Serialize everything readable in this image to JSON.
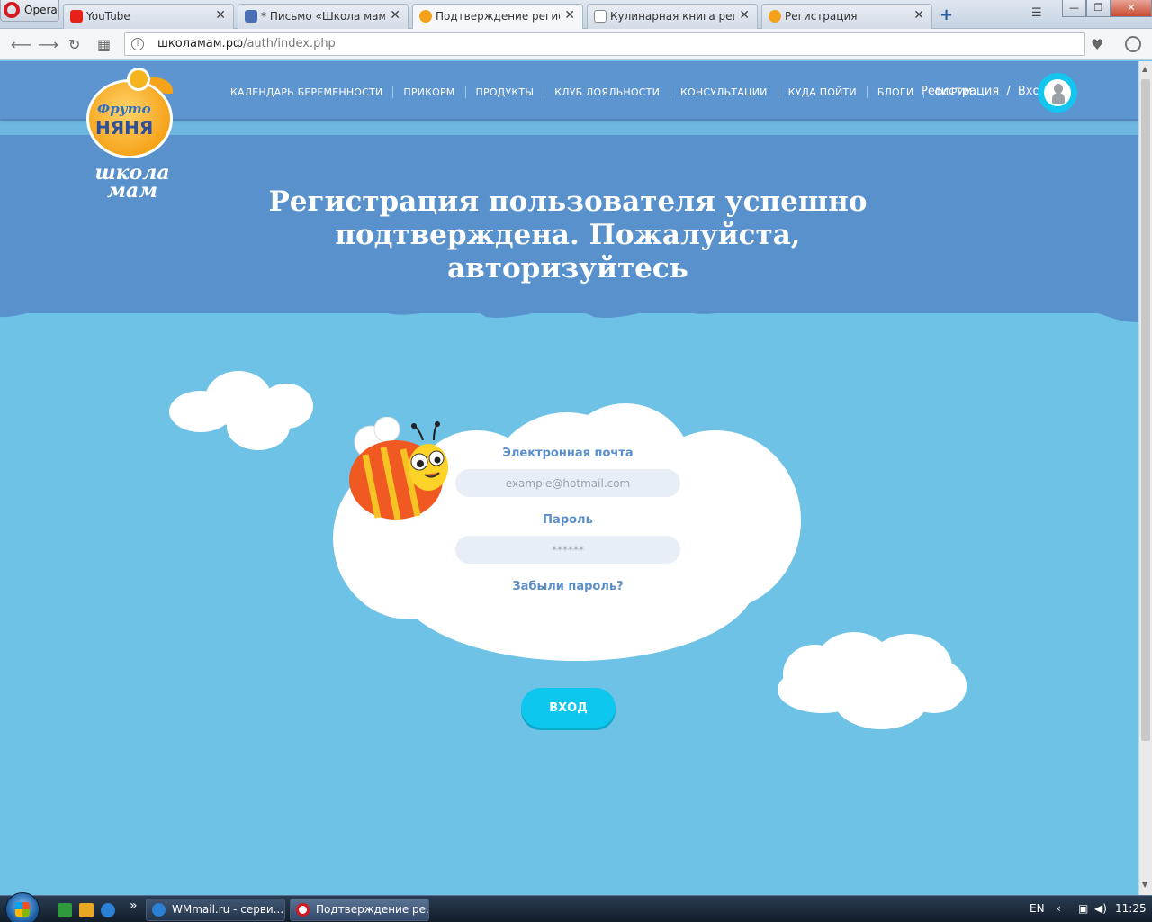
{
  "browser": {
    "menu_label": "Opera",
    "tabs": [
      {
        "title": "YouTube",
        "icon": "youtube-icon",
        "color": "#e62117"
      },
      {
        "title": "* Письмо «Школа мам: П",
        "icon": "mail-icon",
        "color": "#4a6fb5"
      },
      {
        "title": "Подтверждение регистра",
        "icon": "flower-icon",
        "color": "#f4a21b"
      },
      {
        "title": "Кулинарная книга рецеп",
        "icon": "document-icon",
        "color": "#8a8a8a"
      },
      {
        "title": "Регистрация",
        "icon": "flower-icon",
        "color": "#f4a21b"
      }
    ],
    "url_host": "школамам.рф",
    "url_path": "/auth/index.php"
  },
  "site": {
    "nav": [
      "КАЛЕНДАРЬ БЕРЕМЕННОСТИ",
      "ПРИКОРМ",
      "ПРОДУКТЫ",
      "КЛУБ ЛОЯЛЬНОСТИ",
      "КОНСУЛЬТАЦИИ",
      "КУДА ПОЙТИ",
      "БЛОГИ",
      "ФОРУМ"
    ],
    "register_link": "Регистрация",
    "auth_sep": "/",
    "login_link": "Вход",
    "logo": {
      "line1": "Фруто",
      "line2": "НЯНЯ",
      "line3": "школа мам"
    },
    "headline": "Регистрация пользователя успешно подтверждена. Пожалуйста, авторизуйтесь"
  },
  "form": {
    "email_label": "Электронная почта",
    "email_placeholder": "example@hotmail.com",
    "password_label": "Пароль",
    "password_placeholder": "******",
    "forgot_label": "Забыли пароль?",
    "submit_label": "ВХОД"
  },
  "taskbar": {
    "items": [
      {
        "title": "WMmail.ru - серви...",
        "icon": "ie-icon"
      },
      {
        "title": "Подтверждение ре...",
        "icon": "opera-icon"
      }
    ],
    "overflow": "»",
    "lang": "EN",
    "time": "11:25"
  },
  "colors": {
    "accent": "#0ec7ee",
    "hero": "#5891cb",
    "sky": "#6ec2e6",
    "label": "#5c8ec9"
  }
}
